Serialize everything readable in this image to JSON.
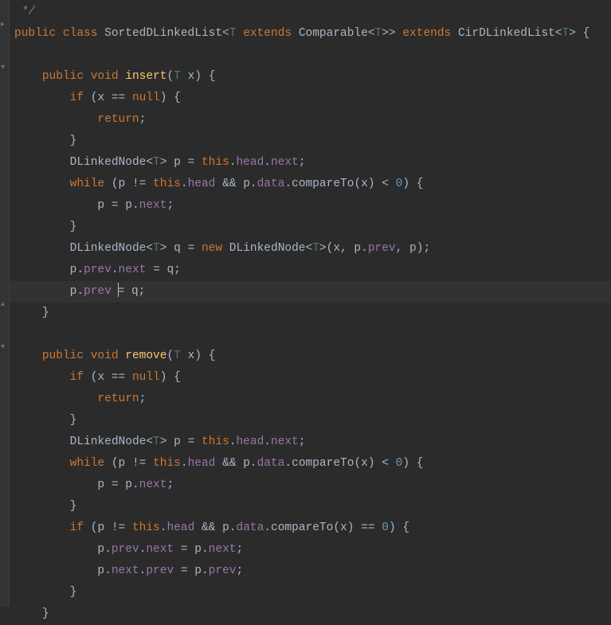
{
  "lines": {
    "l0": {
      "comment_tail": " */"
    },
    "l1": {
      "kw1": "public",
      "kw2": "class",
      "cls": "SortedDLinkedList",
      "lt1": "<",
      "tp1": "T",
      "kw3": "extends",
      "cmp": "Comparable",
      "lt2": "<",
      "tp2": "T",
      "gt2": ">>",
      "kw4": "extends",
      "sup": "CirDLinkedList",
      "lt3": "<",
      "tp3": "T",
      "gt3": ">",
      "ob": "{"
    },
    "l3": {
      "kw1": "public",
      "kw2": "void",
      "fn": "insert",
      "lp": "(",
      "tp": "T",
      "px": "x",
      "rp": ")",
      "ob": "{"
    },
    "l4": {
      "kw": "if",
      "lp": "(",
      "x": "x",
      "eq": "==",
      "nul": "null",
      "rp": ")",
      "ob": "{"
    },
    "l5": {
      "ret": "return",
      "sc": ";"
    },
    "l6": {
      "cb": "}"
    },
    "l7": {
      "cls": "DLinkedNode",
      "lt": "<",
      "tp": "T",
      "gt": ">",
      "p": "p",
      "eq": "=",
      "ths": "this",
      "d1": ".",
      "hd": "head",
      "d2": ".",
      "nx": "next",
      "sc": ";"
    },
    "l8": {
      "kw": "while",
      "lp": "(",
      "p1": "p",
      "ne": "!=",
      "ths": "this",
      "d1": ".",
      "hd": "head",
      "amp": "&&",
      "p2": "p",
      "d2": ".",
      "dt": "data",
      "d3": ".",
      "ct": "compareTo",
      "lp2": "(",
      "x": "x",
      "rp2": ")",
      "lt": "<",
      "zero": "0",
      "rp": ")",
      "ob": "{"
    },
    "l9": {
      "p1": "p",
      "eq": "=",
      "p2": "p",
      "d": ".",
      "nx": "next",
      "sc": ";"
    },
    "l10": {
      "cb": "}"
    },
    "l11": {
      "cls": "DLinkedNode",
      "lt": "<",
      "tp": "T",
      "gt": ">",
      "q": "q",
      "eq": "=",
      "nw": "new",
      "cls2": "DLinkedNode",
      "lt2": "<",
      "tp2": "T",
      "gt2": ">",
      "lp": "(",
      "x": "x",
      "c1": ",",
      "p1": " p",
      "d1": ".",
      "pv": "prev",
      "c2": ",",
      "p2": " p",
      "rp": ")",
      "sc": ";"
    },
    "l12": {
      "p": "p",
      "d1": ".",
      "pv": "prev",
      "d2": ".",
      "nx": "next",
      "eq": "=",
      "q": "q",
      "sc": ";"
    },
    "l13": {
      "p": "p",
      "d1": ".",
      "pv": "prev",
      "eq": "=",
      "q": "q",
      "sc": ";"
    },
    "l14": {
      "cb": "}"
    },
    "l16": {
      "kw1": "public",
      "kw2": "void",
      "fn": "remove",
      "lp": "(",
      "tp": "T",
      "px": "x",
      "rp": ")",
      "ob": "{"
    },
    "l17": {
      "kw": "if",
      "lp": "(",
      "x": "x",
      "eq": "==",
      "nul": "null",
      "rp": ")",
      "ob": "{"
    },
    "l18": {
      "ret": "return",
      "sc": ";"
    },
    "l19": {
      "cb": "}"
    },
    "l20": {
      "cls": "DLinkedNode",
      "lt": "<",
      "tp": "T",
      "gt": ">",
      "p": "p",
      "eq": "=",
      "ths": "this",
      "d1": ".",
      "hd": "head",
      "d2": ".",
      "nx": "next",
      "sc": ";"
    },
    "l21": {
      "kw": "while",
      "lp": "(",
      "p1": "p",
      "ne": "!=",
      "ths": "this",
      "d1": ".",
      "hd": "head",
      "amp": "&&",
      "p2": "p",
      "d2": ".",
      "dt": "data",
      "d3": ".",
      "ct": "compareTo",
      "lp2": "(",
      "x": "x",
      "rp2": ")",
      "lt": "<",
      "zero": "0",
      "rp": ")",
      "ob": "{"
    },
    "l22": {
      "p1": "p",
      "eq": "=",
      "p2": "p",
      "d": ".",
      "nx": "next",
      "sc": ";"
    },
    "l23": {
      "cb": "}"
    },
    "l24": {
      "kw": "if",
      "lp": "(",
      "p1": "p",
      "ne": "!=",
      "ths": "this",
      "d1": ".",
      "hd": "head",
      "amp": "&&",
      "p2": "p",
      "d2": ".",
      "dt": "data",
      "d3": ".",
      "ct": "compareTo",
      "lp2": "(",
      "x": "x",
      "rp2": ")",
      "eq": "==",
      "zero": "0",
      "rp": ")",
      "ob": "{"
    },
    "l25": {
      "p1": "p",
      "d1": ".",
      "pv": "prev",
      "d2": ".",
      "nx": "next",
      "eq": "=",
      "p2": "p",
      "d3": ".",
      "nx2": "next",
      "sc": ";"
    },
    "l26": {
      "p1": "p",
      "d1": ".",
      "nx": "next",
      "d2": ".",
      "pv": "prev",
      "eq": "=",
      "p2": "p",
      "d3": ".",
      "pv2": "prev",
      "sc": ";"
    },
    "l27": {
      "cb": "}"
    },
    "l28": {
      "cb": "}"
    }
  }
}
